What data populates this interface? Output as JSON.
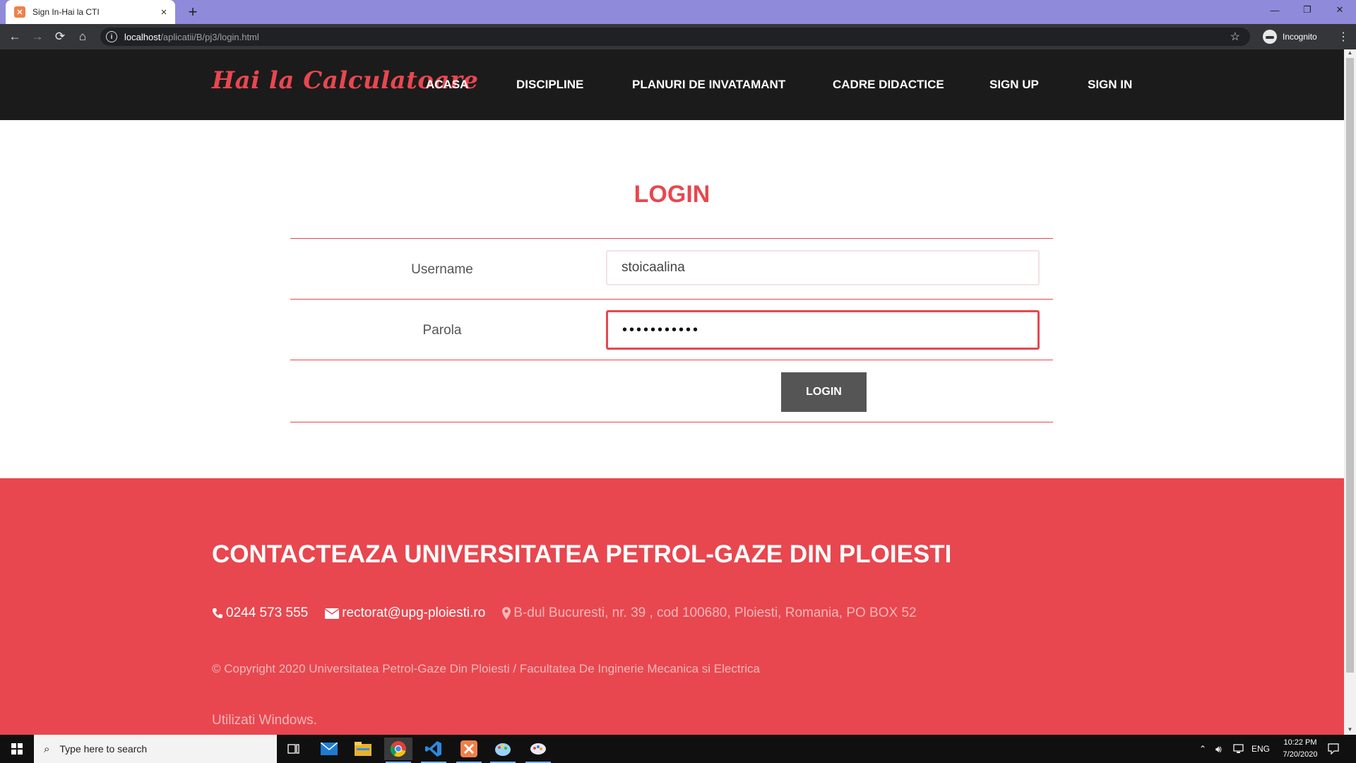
{
  "browser": {
    "tab_title": "Sign In-Hai la CTI",
    "tab_close": "×",
    "new_tab": "+",
    "url_host": "localhost",
    "url_path": "/aplicatii/B/pj3/login.html",
    "incognito_label": "Incognito"
  },
  "site": {
    "brand": "Hai la Calculatoare",
    "nav": [
      "ACASA",
      "DISCIPLINE",
      "PLANURI DE INVATAMANT",
      "CADRE DIDACTICE",
      "SIGN UP",
      "SIGN IN"
    ]
  },
  "login": {
    "title": "LOGIN",
    "username_label": "Username",
    "username_value": "stoicaalina",
    "password_label": "Parola",
    "password_value": "•••••••••••",
    "button_label": "LOGIN"
  },
  "footer": {
    "title": "CONTACTEAZA UNIVERSITATEA PETROL-GAZE DIN PLOIESTI",
    "phone": "0244 573 555",
    "email": "rectorat@upg-ploiesti.ro",
    "address": "B-dul Bucuresti, nr. 39 , cod 100680, Ploiesti, Romania, PO BOX 52",
    "copyright": "© Copyright 2020 Universitatea Petrol-Gaze Din Ploiesti / Facultatea De Inginerie Mecanica si Electrica",
    "watermark": "Utilizati Windows."
  },
  "taskbar": {
    "search_placeholder": "Type here to search",
    "language": "ENG",
    "time": "10:22 PM",
    "date": "7/20/2020"
  },
  "colors": {
    "accent": "#e8474f",
    "nav_bg": "#1b1b1b",
    "tab_strip": "#8f8ada",
    "button_bg": "#555555"
  }
}
